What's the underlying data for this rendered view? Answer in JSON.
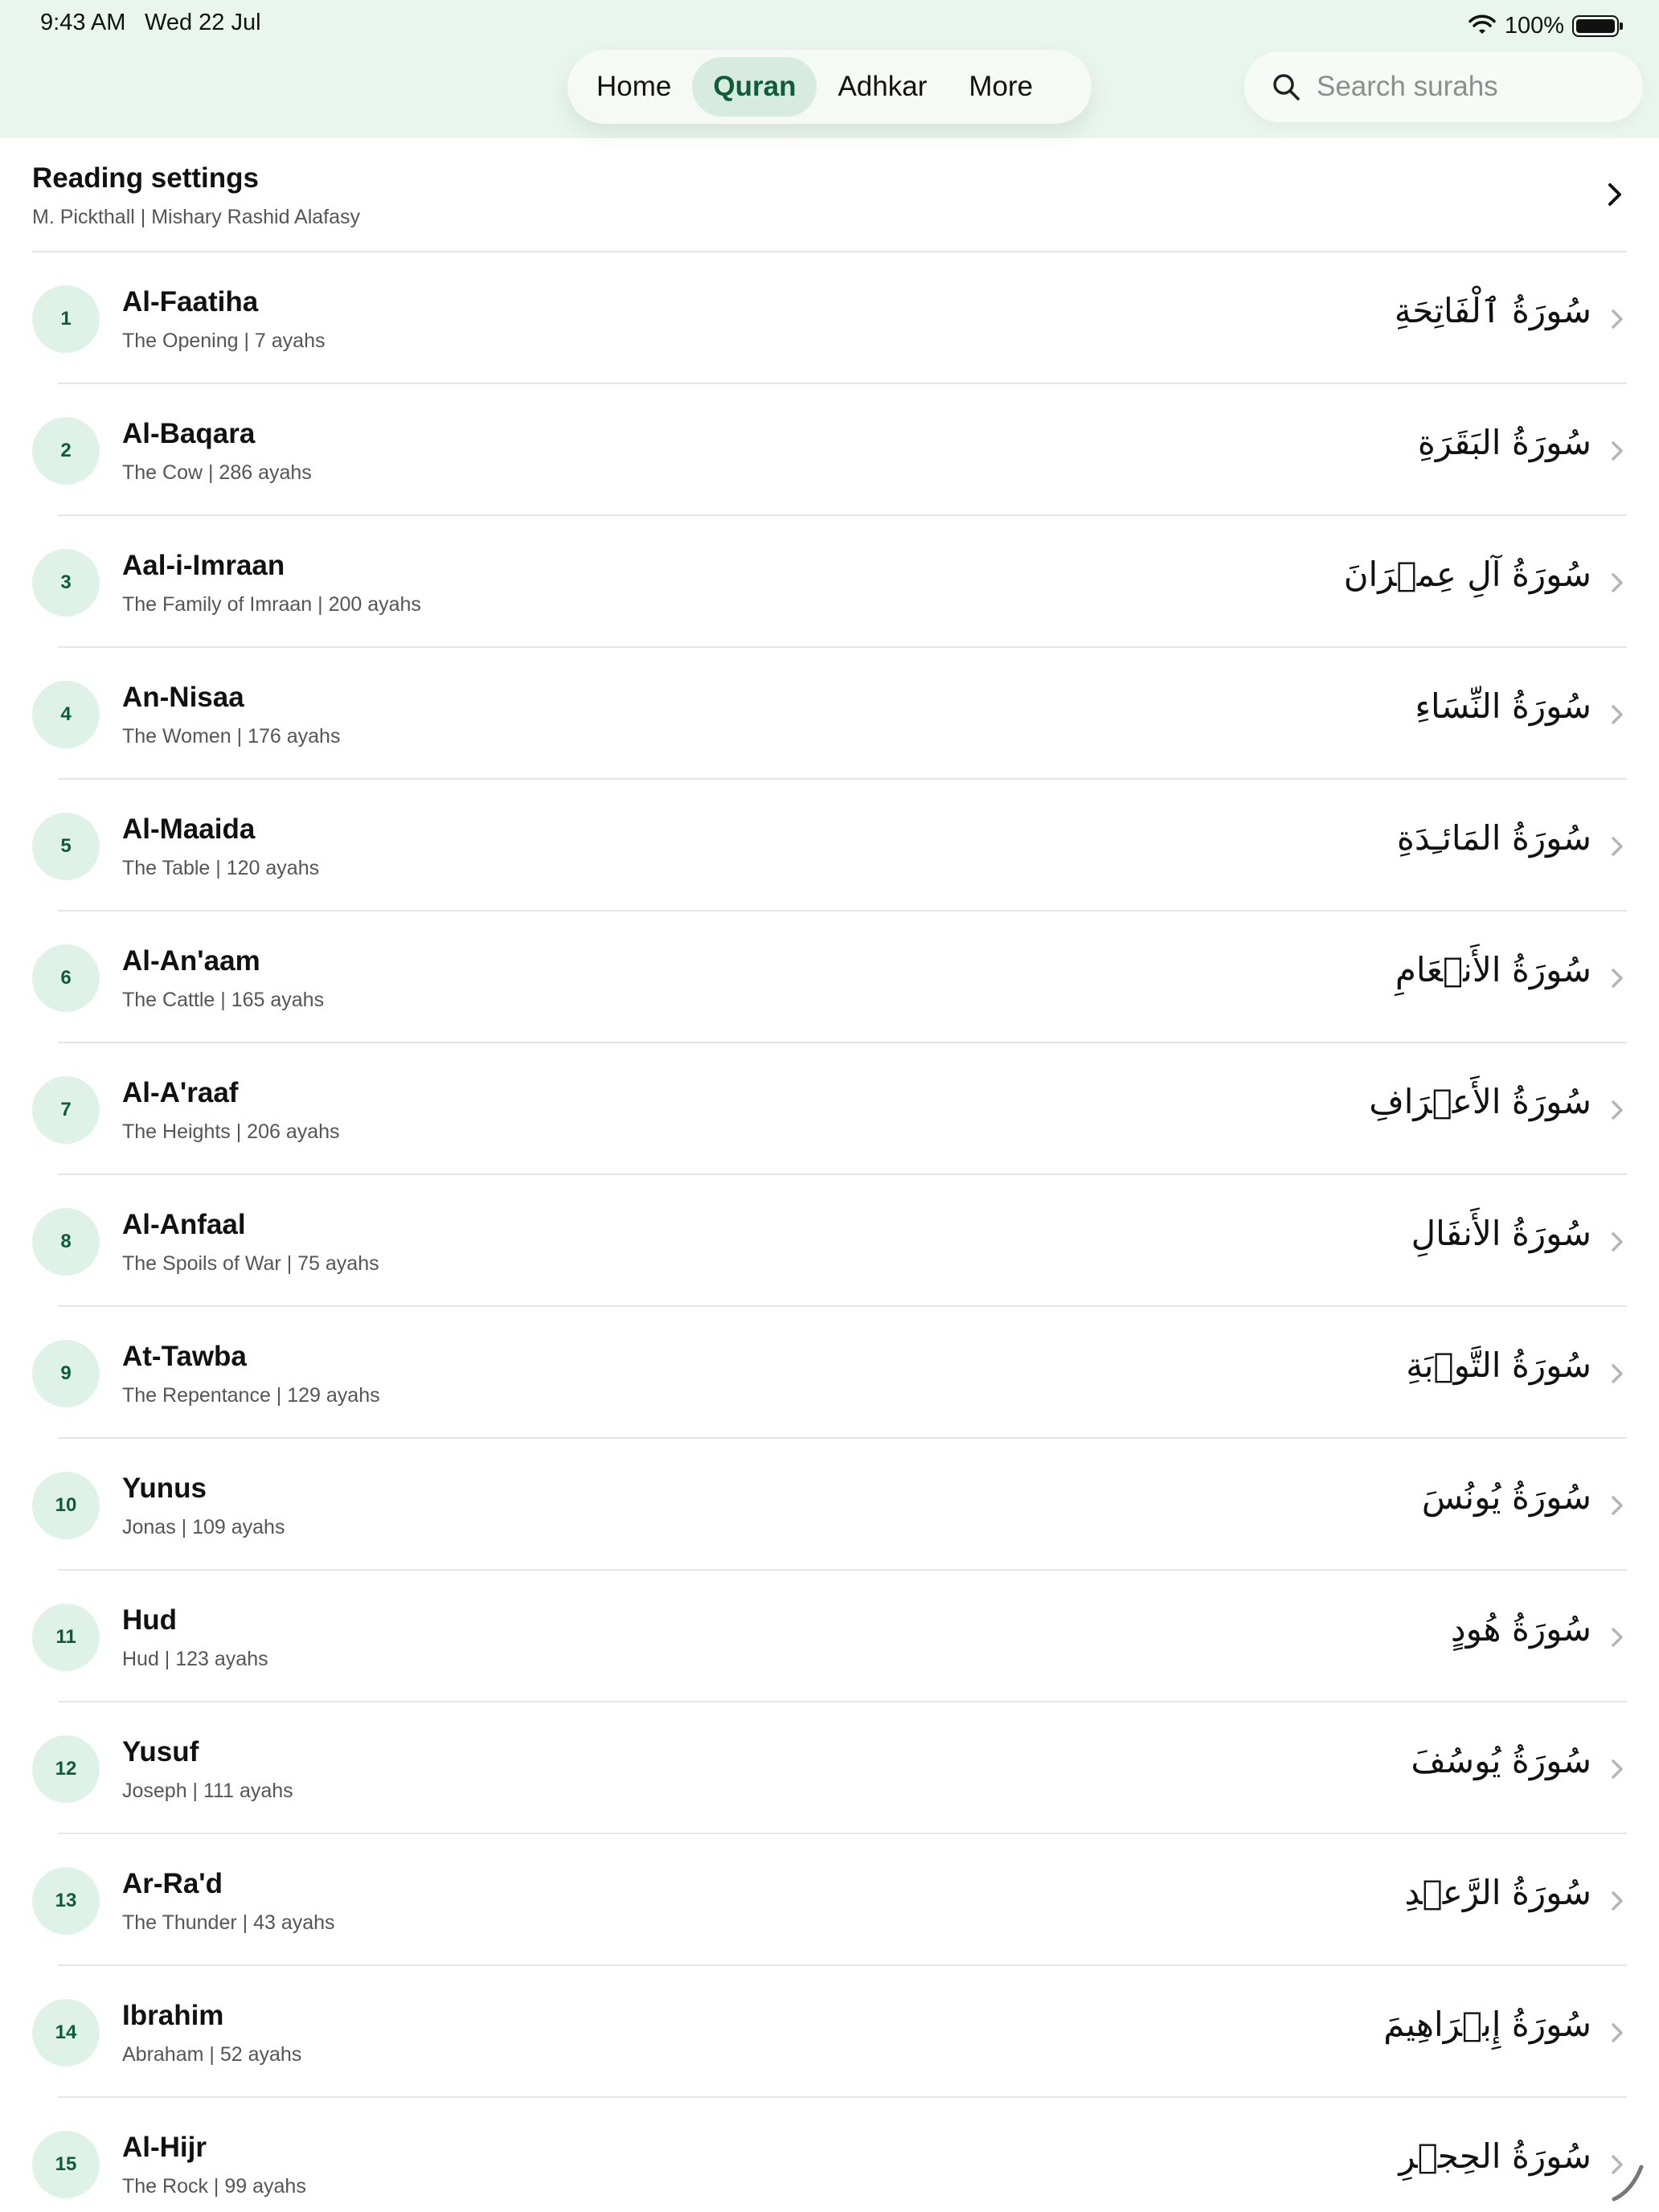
{
  "status": {
    "time": "9:43 AM",
    "date": "Wed 22 Jul",
    "battery": "100%"
  },
  "tabs": [
    {
      "label": "Home",
      "active": false
    },
    {
      "label": "Quran",
      "active": true
    },
    {
      "label": "Adhkar",
      "active": false
    },
    {
      "label": "More",
      "active": false
    }
  ],
  "search": {
    "placeholder": "Search surahs"
  },
  "settings": {
    "title": "Reading settings",
    "subtitle": "M. Pickthall  |  Mishary Rashid Alafasy"
  },
  "colors": {
    "accent": "#0f5c3a",
    "badge_bg": "#dff2e8",
    "header_bg": "#eaf5ef"
  },
  "surahs": [
    {
      "number": "1",
      "name": "Al-Faatiha",
      "meta": "The Opening  |  7 ayahs",
      "arabic": "سُورَةُ ٱلْفَاتِحَةِ"
    },
    {
      "number": "2",
      "name": "Al-Baqara",
      "meta": "The Cow  |  286 ayahs",
      "arabic": "سُورَةُ البَقَرَةِ"
    },
    {
      "number": "3",
      "name": "Aal-i-Imraan",
      "meta": "The Family of Imraan  |  200 ayahs",
      "arabic": "سُورَةُ آلِ عِمۡرَانَ"
    },
    {
      "number": "4",
      "name": "An-Nisaa",
      "meta": "The Women  |  176 ayahs",
      "arabic": "سُورَةُ النِّسَاءِ"
    },
    {
      "number": "5",
      "name": "Al-Maaida",
      "meta": "The Table  |  120 ayahs",
      "arabic": "سُورَةُ المَائـِدَةِ"
    },
    {
      "number": "6",
      "name": "Al-An'aam",
      "meta": "The Cattle  |  165 ayahs",
      "arabic": "سُورَةُ الأَنۡعَامِ"
    },
    {
      "number": "7",
      "name": "Al-A'raaf",
      "meta": "The Heights  |  206 ayahs",
      "arabic": "سُورَةُ الأَعۡرَافِ"
    },
    {
      "number": "8",
      "name": "Al-Anfaal",
      "meta": "The Spoils of War  |  75 ayahs",
      "arabic": "سُورَةُ الأَنفَالِ"
    },
    {
      "number": "9",
      "name": "At-Tawba",
      "meta": "The Repentance  |  129 ayahs",
      "arabic": "سُورَةُ التَّوۡبَةِ"
    },
    {
      "number": "10",
      "name": "Yunus",
      "meta": "Jonas  |  109 ayahs",
      "arabic": "سُورَةُ يُونُسَ"
    },
    {
      "number": "11",
      "name": "Hud",
      "meta": "Hud  |  123 ayahs",
      "arabic": "سُورَةُ هُودٍ"
    },
    {
      "number": "12",
      "name": "Yusuf",
      "meta": "Joseph  |  111 ayahs",
      "arabic": "سُورَةُ يُوسُفَ"
    },
    {
      "number": "13",
      "name": "Ar-Ra'd",
      "meta": "The Thunder  |  43 ayahs",
      "arabic": "سُورَةُ الرَّعۡدِ"
    },
    {
      "number": "14",
      "name": "Ibrahim",
      "meta": "Abraham  |  52 ayahs",
      "arabic": "سُورَةُ إِبۡرَاهِيمَ"
    },
    {
      "number": "15",
      "name": "Al-Hijr",
      "meta": "The Rock  |  99 ayahs",
      "arabic": "سُورَةُ الحِجۡرِ"
    }
  ]
}
